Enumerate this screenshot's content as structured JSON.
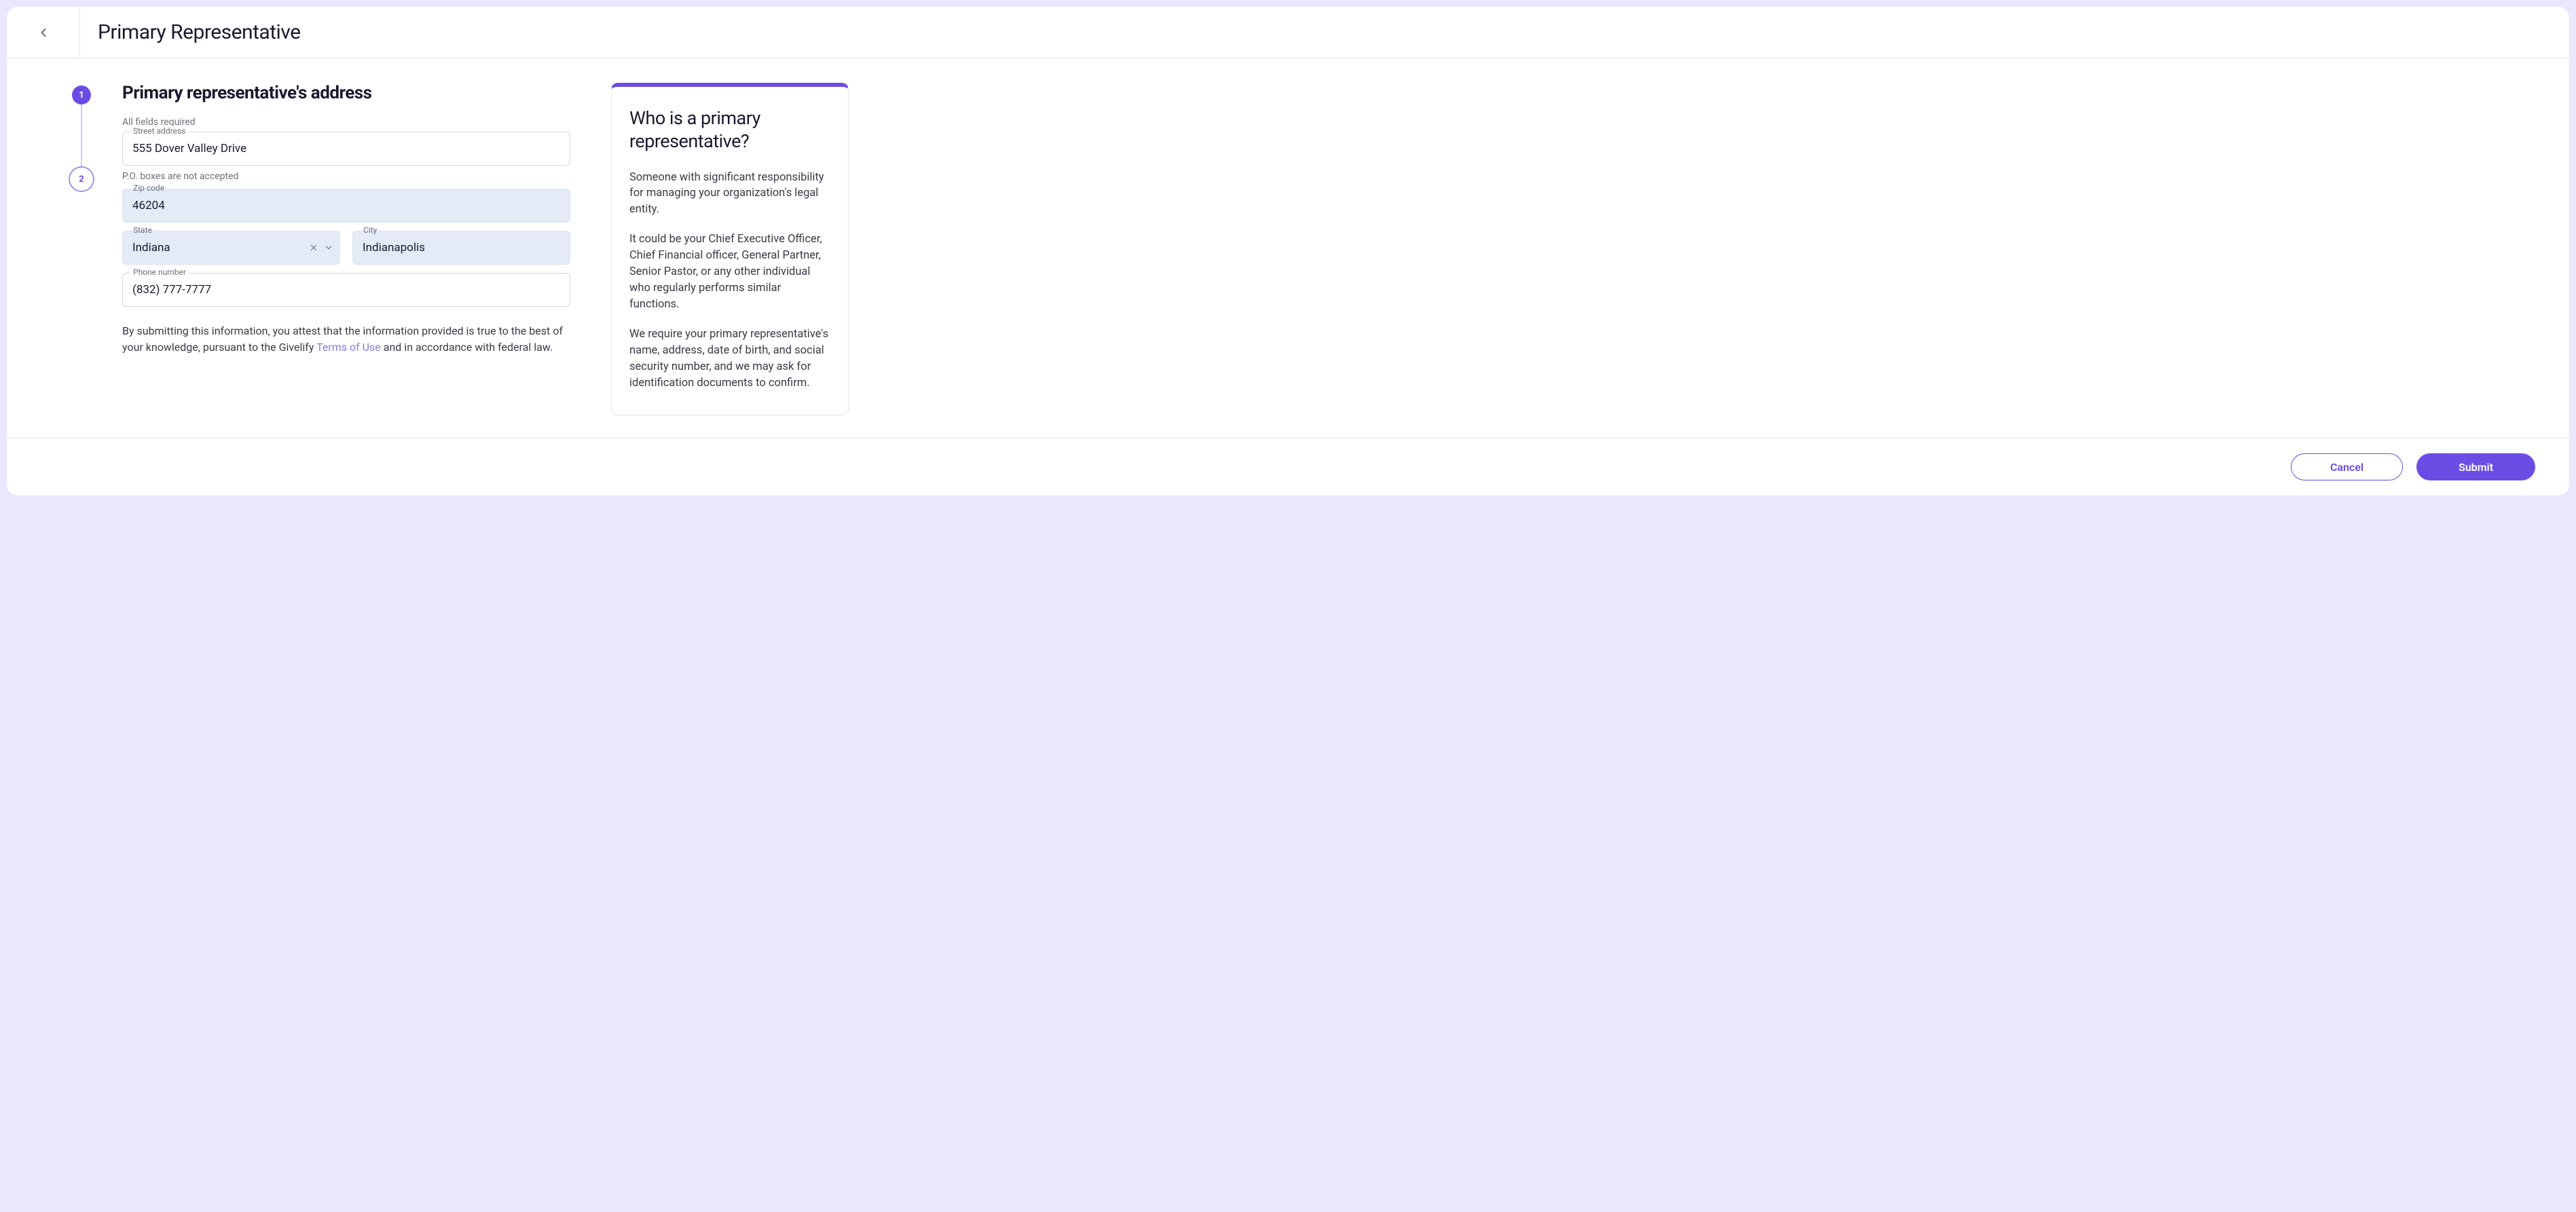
{
  "header": {
    "title": "Primary Representative"
  },
  "progress": {
    "step1": "1",
    "step2": "2"
  },
  "form": {
    "title": "Primary representative's address",
    "required_hint": "All fields required",
    "street_label": "Street address",
    "street_value": "555 Dover Valley Drive",
    "po_note": "P.O. boxes are not accepted",
    "zip_label": "Zip code",
    "zip_value": "46204",
    "state_label": "State",
    "state_value": "Indiana",
    "city_label": "City",
    "city_value": "Indianapolis",
    "phone_label": "Phone number",
    "phone_value": "(832) 777-7777"
  },
  "disclosure": {
    "pre": "By submitting this information, you attest that the information provided is true to the best of your knowledge, pursuant to the Givelify ",
    "link": "Terms of Use",
    "post": " and in accordance with federal law."
  },
  "info": {
    "title": "Who is a primary representative?",
    "p1": "Someone with significant responsibility for managing your organization's legal entity.",
    "p2": "It could be your Chief Executive Officer, Chief Financial officer, General Partner, Senior Pastor, or any other individual who regularly performs similar functions.",
    "p3": "We require your primary representative's name, address, date of birth, and social security number, and we may ask for identification documents to confirm."
  },
  "footer": {
    "cancel": "Cancel",
    "submit": "Submit"
  }
}
